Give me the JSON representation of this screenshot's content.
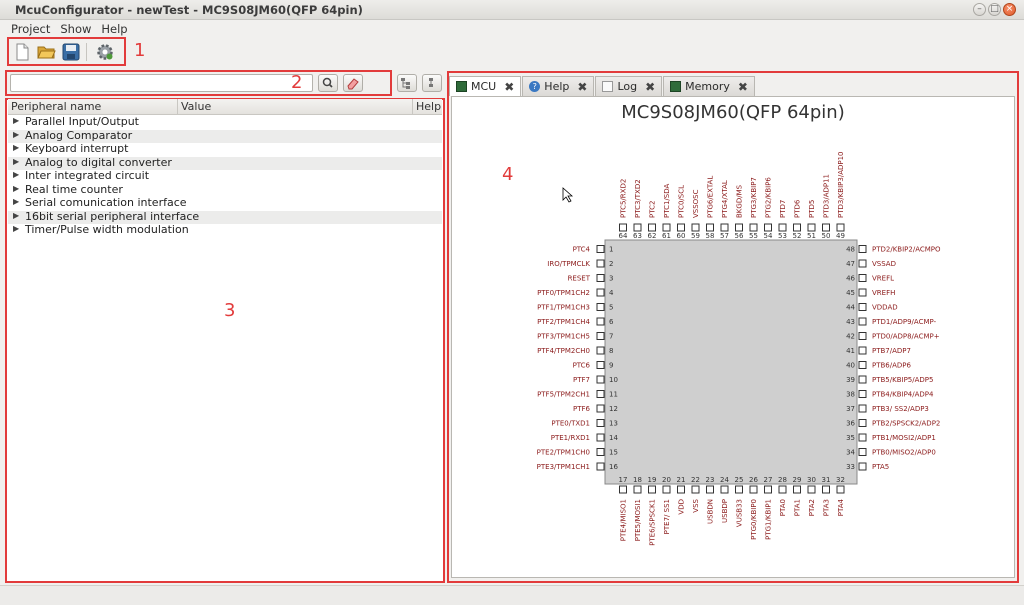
{
  "window": {
    "title": "McuConfigurator - newTest - MC9S08JM60(QFP 64pin)",
    "controls": [
      "minimize",
      "maximize",
      "close"
    ]
  },
  "menu": [
    "Project",
    "Show",
    "Help"
  ],
  "toolbar": {
    "buttons": [
      {
        "name": "new-file",
        "icon": "new-document-icon"
      },
      {
        "name": "open",
        "icon": "folder-open-icon"
      },
      {
        "name": "save",
        "icon": "floppy-disk-icon"
      },
      {
        "name": "generate",
        "icon": "gear-icon"
      }
    ]
  },
  "annotations": {
    "l1": "1",
    "l2": "2",
    "l3": "3",
    "l4": "4"
  },
  "search": {
    "value": "",
    "placeholder": ""
  },
  "tree": {
    "columns": {
      "name": "Peripheral name",
      "value": "Value",
      "help": "Help"
    },
    "items": [
      "Parallel Input/Output",
      "Analog Comparator",
      "Keyboard interrupt",
      "Analog to digital converter",
      "Inter integrated circuit",
      "Real time counter",
      "Serial comunication interface",
      "16bit serial peripheral interface",
      "Timer/Pulse width modulation"
    ]
  },
  "tabs": [
    {
      "label": "MCU",
      "active": true
    },
    {
      "label": "Help",
      "active": false
    },
    {
      "label": "Log",
      "active": false
    },
    {
      "label": "Memory",
      "active": false
    }
  ],
  "chip": {
    "title": "MC9S08JM60(QFP 64pin)",
    "pin_color": "#8b1a1a",
    "body_color": "#cfcfcf",
    "left": [
      {
        "n": "1",
        "name": "PTC4"
      },
      {
        "n": "2",
        "name": "IRO/TPMCLK"
      },
      {
        "n": "3",
        "name": "RESET"
      },
      {
        "n": "4",
        "name": "PTF0/TPM1CH2"
      },
      {
        "n": "5",
        "name": "PTF1/TPM1CH3"
      },
      {
        "n": "6",
        "name": "PTF2/TPM1CH4"
      },
      {
        "n": "7",
        "name": "PTF3/TPM1CH5"
      },
      {
        "n": "8",
        "name": "PTF4/TPM2CH0"
      },
      {
        "n": "9",
        "name": "PTC6"
      },
      {
        "n": "10",
        "name": "PTF7"
      },
      {
        "n": "11",
        "name": "PTF5/TPM2CH1"
      },
      {
        "n": "12",
        "name": "PTF6"
      },
      {
        "n": "13",
        "name": "PTE0/TXD1"
      },
      {
        "n": "14",
        "name": "PTE1/RXD1"
      },
      {
        "n": "15",
        "name": "PTE2/TPM1CH0"
      },
      {
        "n": "16",
        "name": "PTE3/TPM1CH1"
      }
    ],
    "right": [
      {
        "n": "48",
        "name": "PTD2/KBIP2/ACMPO"
      },
      {
        "n": "47",
        "name": "VSSAD"
      },
      {
        "n": "46",
        "name": "VREFL"
      },
      {
        "n": "45",
        "name": "VREFH"
      },
      {
        "n": "44",
        "name": "VDDAD"
      },
      {
        "n": "43",
        "name": "PTD1/ADP9/ACMP-"
      },
      {
        "n": "42",
        "name": "PTD0/ADP8/ACMP+"
      },
      {
        "n": "41",
        "name": "PTB7/ADP7"
      },
      {
        "n": "40",
        "name": "PTB6/ADP6"
      },
      {
        "n": "39",
        "name": "PTB5/KBIP5/ADP5"
      },
      {
        "n": "38",
        "name": "PTB4/KBIP4/ADP4"
      },
      {
        "n": "37",
        "name": "PTB3/ SS2/ADP3"
      },
      {
        "n": "36",
        "name": "PTB2/SPSCK2/ADP2"
      },
      {
        "n": "35",
        "name": "PTB1/MOSI2/ADP1"
      },
      {
        "n": "34",
        "name": "PTB0/MISO2/ADP0"
      },
      {
        "n": "33",
        "name": "PTA5"
      }
    ],
    "top": [
      {
        "n": "64",
        "name": "PTC5/RXD2"
      },
      {
        "n": "63",
        "name": "PTC3/TXD2"
      },
      {
        "n": "62",
        "name": "PTC2"
      },
      {
        "n": "61",
        "name": "PTC1/SDA"
      },
      {
        "n": "60",
        "name": "PTC0/SCL"
      },
      {
        "n": "59",
        "name": "VSSOSC"
      },
      {
        "n": "58",
        "name": "PTG6/EXTAL"
      },
      {
        "n": "57",
        "name": "PTG4/XTAL"
      },
      {
        "n": "56",
        "name": "BKGD/MS"
      },
      {
        "n": "55",
        "name": "PTG3/KBIP7"
      },
      {
        "n": "54",
        "name": "PTG2/KBIP6"
      },
      {
        "n": "53",
        "name": "PTD7"
      },
      {
        "n": "52",
        "name": "PTD6"
      },
      {
        "n": "51",
        "name": "PTD5"
      },
      {
        "n": "50",
        "name": "PTD3/ADP11"
      },
      {
        "n": "49",
        "name": "PTD3/KBIP3/ADP10"
      }
    ],
    "bottom": [
      {
        "n": "17",
        "name": "PTE4/MISO1"
      },
      {
        "n": "18",
        "name": "PTE5/MOSI1"
      },
      {
        "n": "19",
        "name": "PTE6/SPSCK1"
      },
      {
        "n": "20",
        "name": "PTE7/ SS1"
      },
      {
        "n": "21",
        "name": "VDD"
      },
      {
        "n": "22",
        "name": "VSS"
      },
      {
        "n": "23",
        "name": "USBDN"
      },
      {
        "n": "24",
        "name": "USBDP"
      },
      {
        "n": "25",
        "name": "VUSB33"
      },
      {
        "n": "26",
        "name": "PTG0/KBIP0"
      },
      {
        "n": "27",
        "name": "PTG1/KBIP1"
      },
      {
        "n": "28",
        "name": "PTA0"
      },
      {
        "n": "29",
        "name": "PTA1"
      },
      {
        "n": "30",
        "name": "PTA2"
      },
      {
        "n": "31",
        "name": "PTA3"
      },
      {
        "n": "32",
        "name": "PTA4"
      }
    ]
  }
}
